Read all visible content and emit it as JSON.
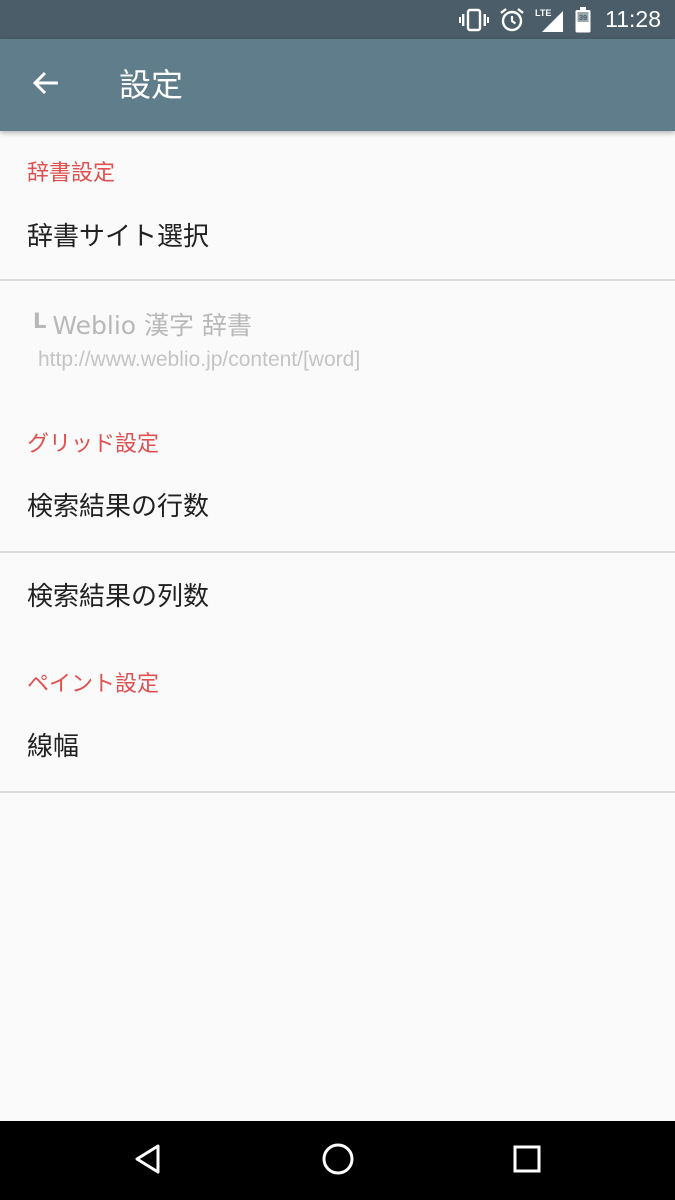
{
  "status_bar": {
    "time": "11:28",
    "icons": [
      "vibrate-icon",
      "alarm-icon",
      "lte-signal-icon",
      "battery-icon"
    ],
    "lte_label": "LTE",
    "battery_level": "39"
  },
  "app_bar": {
    "back_icon": "arrow-back-icon",
    "title": "設定"
  },
  "sections": {
    "dictionary": {
      "header": "辞書設定",
      "site_select": "辞書サイト選択",
      "current_site_mark": "L",
      "current_site_name": "Weblio 漢字 辞書",
      "current_site_url": "http://www.weblio.jp/content/[word]"
    },
    "grid": {
      "header": "グリッド設定",
      "rows": "検索結果の行数",
      "columns": "検索結果の列数"
    },
    "paint": {
      "header": "ペイント設定",
      "line_width": "線幅"
    }
  },
  "nav_bar": {
    "buttons": [
      "back-triangle-icon",
      "home-circle-icon",
      "recents-square-icon"
    ]
  },
  "colors": {
    "status_bar": "#4a5d68",
    "app_bar": "#607d8b",
    "category_text": "#e05050",
    "background": "#fafafa"
  }
}
